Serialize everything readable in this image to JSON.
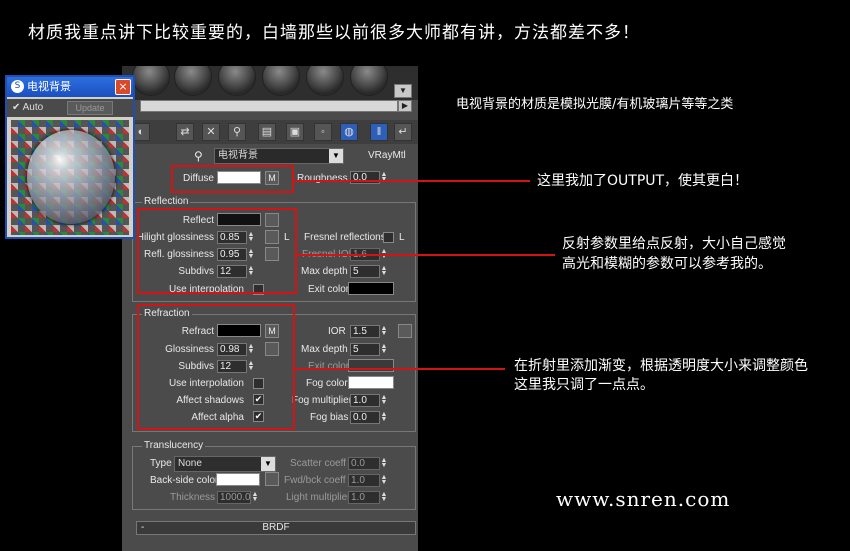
{
  "header": {
    "title": "材质我重点讲下比较重要的，白墙那些以前很多大师都有讲，方法都差不多！"
  },
  "notes": {
    "material_desc": "电视背景的材质是模拟光膜/有机玻璃片等等之类",
    "diffuse_note": "这里我加了OUTPUT，使其更白！",
    "reflection_note_1": "反射参数里给点反射，大小自己感觉",
    "reflection_note_2": "高光和模糊的参数可以参考我的。",
    "refraction_note_1": "在折射里添加渐变，根据透明度大小来调整颜色",
    "refraction_note_2": "这里我只调了一点点。",
    "watermark": "www.snren.com"
  },
  "preview": {
    "title": "电视背景",
    "auto_label": "Auto",
    "auto_checked": true,
    "update_label": "Update",
    "close_icon": "×"
  },
  "material": {
    "name": "电视背景",
    "type": "VRayMtl"
  },
  "basic": {
    "diffuse_label": "Diffuse",
    "diffuse_color": "#ffffff",
    "diffuse_map": "M",
    "roughness_label": "Roughness",
    "roughness_value": "0.0"
  },
  "reflection": {
    "group_label": "Reflection",
    "reflect_label": "Reflect",
    "hilight_label": "Hilight glossiness",
    "hilight_value": "0.85",
    "hilight_lock": "L",
    "refl_gloss_label": "Refl. glossiness",
    "refl_gloss_value": "0.95",
    "subdivs_label": "Subdivs",
    "subdivs_value": "12",
    "use_interp_label": "Use interpolation",
    "fresnel_label": "Fresnel reflections",
    "fresnel_lock": "L",
    "fresnel_ior_label": "Fresnel IOR",
    "fresnel_ior_value": "1.6",
    "max_depth_label": "Max depth",
    "max_depth_value": "5",
    "exit_color_label": "Exit color"
  },
  "refraction": {
    "group_label": "Refraction",
    "refract_label": "Refract",
    "refract_map": "M",
    "glossiness_label": "Glossiness",
    "glossiness_value": "0.98",
    "subdivs_label": "Subdivs",
    "subdivs_value": "12",
    "use_interp_label": "Use interpolation",
    "affect_shadows_label": "Affect shadows",
    "affect_alpha_label": "Affect alpha",
    "ior_label": "IOR",
    "ior_value": "1.5",
    "max_depth_label": "Max depth",
    "max_depth_value": "5",
    "exit_color_label": "Exit color",
    "fog_color_label": "Fog color",
    "fog_mult_label": "Fog multiplier",
    "fog_mult_value": "1.0",
    "fog_bias_label": "Fog bias",
    "fog_bias_value": "0.0"
  },
  "translucency": {
    "group_label": "Translucency",
    "type_label": "Type",
    "type_value": "None",
    "backside_label": "Back-side color",
    "thickness_label": "Thickness",
    "thickness_value": "1000.0",
    "scatter_label": "Scatter coeff",
    "scatter_value": "0.0",
    "fwdbck_label": "Fwd/bck coeff",
    "fwdbck_value": "1.0",
    "light_mult_label": "Light multiplier",
    "light_mult_value": "1.0"
  },
  "brdf": {
    "label": "BRDF",
    "collapse": "-"
  },
  "colors": {
    "callout": "#d41414",
    "selected_tool": "#2d5fb8"
  },
  "icons": [
    "material-sphere-icon",
    "pick-material-icon",
    "delete-icon",
    "assign-icon",
    "checker-icon",
    "go-to-parent-icon"
  ]
}
